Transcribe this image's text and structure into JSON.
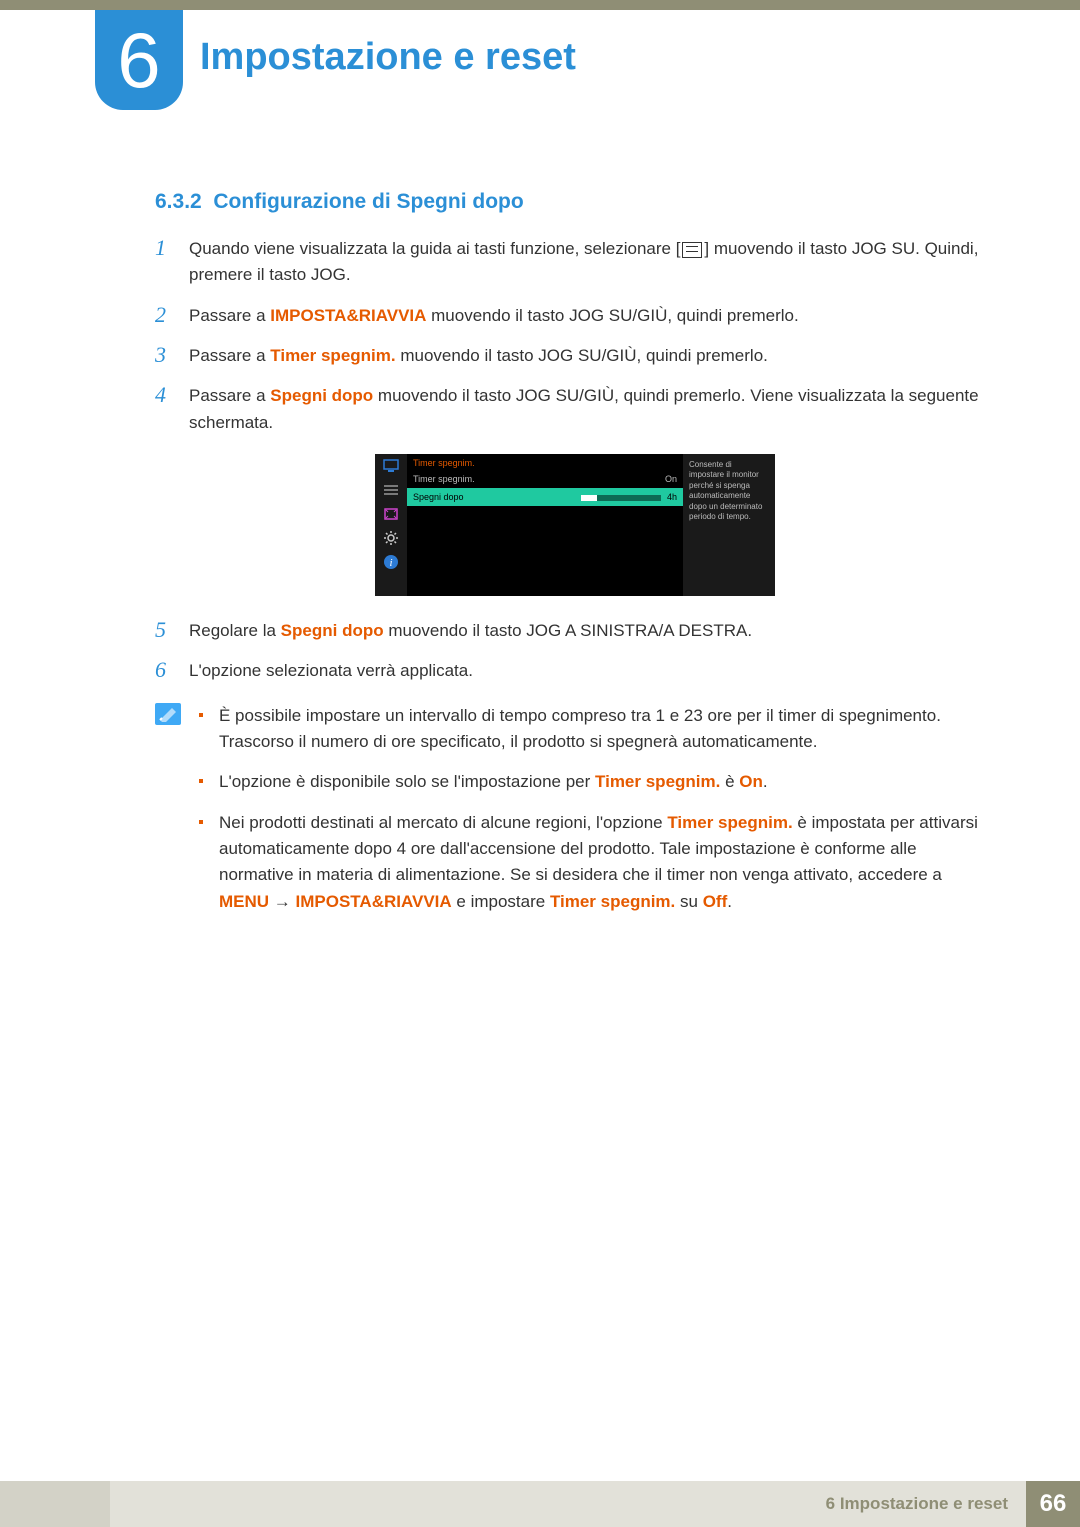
{
  "chapter": {
    "number": "6",
    "title": "Impostazione e reset"
  },
  "section": {
    "number": "6.3.2",
    "title": "Configurazione di Spegni dopo"
  },
  "steps": {
    "s1": {
      "n": "1",
      "pre": "Quando viene visualizzata la guida ai tasti funzione, selezionare [",
      "post": "] muovendo il tasto JOG SU. Quindi, premere il tasto JOG."
    },
    "s2": {
      "n": "2",
      "a": "Passare a ",
      "hl": "IMPOSTA&RIAVVIA",
      "b": " muovendo il tasto JOG SU/GIÙ, quindi premerlo."
    },
    "s3": {
      "n": "3",
      "a": "Passare a ",
      "hl": "Timer spegnim.",
      "b": " muovendo il tasto JOG SU/GIÙ, quindi premerlo."
    },
    "s4": {
      "n": "4",
      "a": "Passare a ",
      "hl": "Spegni dopo",
      "b": " muovendo il tasto JOG SU/GIÙ, quindi premerlo. Viene visualizzata la seguente schermata."
    },
    "s5": {
      "n": "5",
      "a": "Regolare la ",
      "hl": "Spegni dopo",
      "b": " muovendo il tasto JOG A SINISTRA/A DESTRA."
    },
    "s6": {
      "n": "6",
      "a": "L'opzione selezionata verrà applicata."
    }
  },
  "osd": {
    "title": "Timer spegnim.",
    "row1": {
      "label": "Timer spegnim.",
      "value": "On"
    },
    "row2": {
      "label": "Spegni dopo",
      "value": "4h"
    },
    "help": "Consente di impostare il monitor perché si spenga automaticamente dopo un determinato periodo di tempo."
  },
  "notes": {
    "n1": "È possibile impostare un intervallo di tempo compreso tra 1 e 23 ore per il timer di spegnimento. Trascorso il numero di ore specificato, il prodotto si spegnerà automaticamente.",
    "n2": {
      "a": "L'opzione è disponibile solo se l'impostazione per ",
      "hl1": "Timer spegnim.",
      "b": " è ",
      "hl2": "On",
      "c": "."
    },
    "n3": {
      "a": "Nei prodotti destinati al mercato di alcune regioni, l'opzione ",
      "hl1": "Timer spegnim.",
      "b": " è impostata per attivarsi automaticamente dopo 4 ore dall'accensione del prodotto. Tale impostazione è conforme alle normative in materia di alimentazione. Se si desidera che il timer non venga attivato, accedere a ",
      "hl2": "MENU",
      "arrow": " → ",
      "hl3": "IMPOSTA&RIAVVIA",
      "c": " e impostare ",
      "hl4": "Timer spegnim.",
      "d": " su ",
      "hl5": "Off",
      "e": "."
    }
  },
  "footer": {
    "chapter": "6 Impostazione e reset",
    "page": "66"
  }
}
